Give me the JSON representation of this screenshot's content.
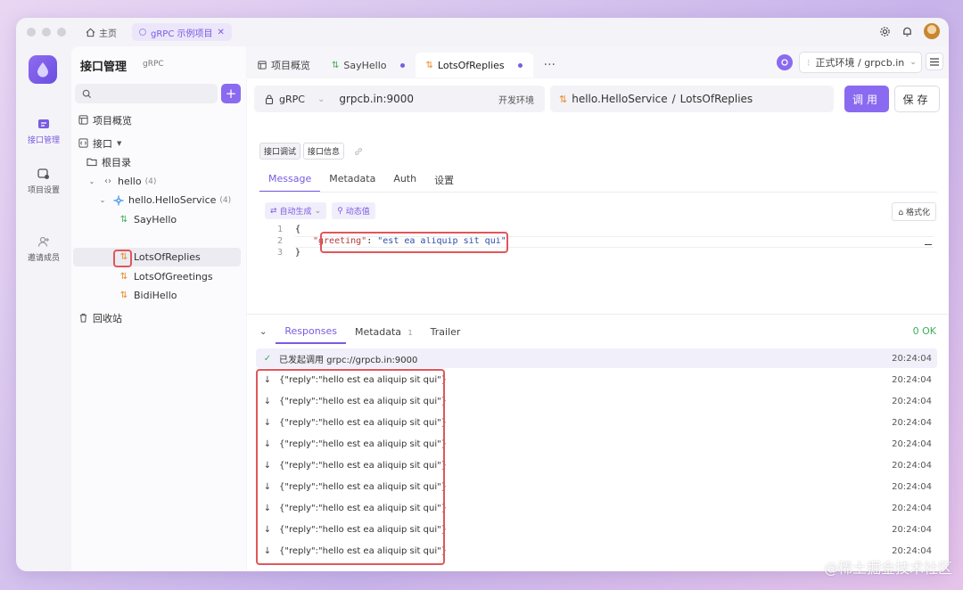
{
  "titlebar": {
    "home_label": "主页",
    "project_tab_label": "gRPC 示例项目"
  },
  "rail": {
    "items": [
      {
        "label": "接口管理",
        "icon": "api-icon",
        "active": true
      },
      {
        "label": "项目设置",
        "icon": "settings-icon",
        "active": false
      },
      {
        "label": "邀请成员",
        "icon": "add-user-icon",
        "active": false
      }
    ]
  },
  "sidebar": {
    "title": "接口管理",
    "badge": "gRPC",
    "search_placeholder": "",
    "tree": [
      {
        "label": "项目概览",
        "icon": "overview-icon"
      },
      {
        "label": "接口",
        "icon": "api-icon"
      },
      {
        "label": "根目录",
        "icon": "folder-icon"
      },
      {
        "label": "hello",
        "count": "(4)",
        "icon": "code-icon"
      },
      {
        "label": "hello.HelloService",
        "count": "(4)",
        "icon": "service-icon"
      },
      {
        "label": "SayHello",
        "icon": "unary-icon"
      },
      {
        "label": "LotsOfReplies",
        "icon": "stream-icon"
      },
      {
        "label": "LotsOfGreetings",
        "icon": "stream-icon"
      },
      {
        "label": "BidiHello",
        "icon": "stream-icon"
      },
      {
        "label": "回收站",
        "icon": "trash-icon"
      }
    ]
  },
  "tabs": [
    {
      "label": "项目概览"
    },
    {
      "label": "SayHello"
    },
    {
      "label": "LotsOfReplies"
    }
  ],
  "env": {
    "label": "正式环境 / grpcb.in"
  },
  "request": {
    "protocol": "gRPC",
    "host": "grpcb.in:9000",
    "env_label": "开发环境",
    "method_service": "hello.HelloService",
    "method_sep": "/",
    "method_name": "LotsOfReplies",
    "call_label": "调用",
    "save_label": "保存"
  },
  "subtabs": [
    "接口调试",
    "接口信息"
  ],
  "message_tabs": [
    "Message",
    "Metadata",
    "Auth",
    "设置"
  ],
  "editor": {
    "auto_gen": "自动生成",
    "dynamic": "动态值",
    "format": "格式化",
    "lines": [
      "1",
      "2",
      "3"
    ],
    "open_brace": "{",
    "key": "\"greeting\"",
    "colon": ": ",
    "value": "\"est ea aliquip sit qui\"",
    "close_brace": "}"
  },
  "responses": {
    "tabs": [
      {
        "label": "Responses"
      },
      {
        "label": "Metadata",
        "count": "1"
      },
      {
        "label": "Trailer"
      }
    ],
    "status": "0 OK",
    "first": {
      "text": "已发起调用 grpc://grpcb.in:9000",
      "time": "20:24:04"
    },
    "rows": [
      {
        "text": "{\"reply\":\"hello est ea aliquip sit qui\"}",
        "time": "20:24:04"
      },
      {
        "text": "{\"reply\":\"hello est ea aliquip sit qui\"}",
        "time": "20:24:04"
      },
      {
        "text": "{\"reply\":\"hello est ea aliquip sit qui\"}",
        "time": "20:24:04"
      },
      {
        "text": "{\"reply\":\"hello est ea aliquip sit qui\"}",
        "time": "20:24:04"
      },
      {
        "text": "{\"reply\":\"hello est ea aliquip sit qui\"}",
        "time": "20:24:04"
      },
      {
        "text": "{\"reply\":\"hello est ea aliquip sit qui\"}",
        "time": "20:24:04"
      },
      {
        "text": "{\"reply\":\"hello est ea aliquip sit qui\"}",
        "time": "20:24:04"
      },
      {
        "text": "{\"reply\":\"hello est ea aliquip sit qui\"}",
        "time": "20:24:04"
      },
      {
        "text": "{\"reply\":\"hello est ea aliquip sit qui\"}",
        "time": "20:24:04"
      }
    ]
  },
  "watermark": "@稀土掘金技术社区",
  "colors": {
    "accent": "#8a6af0",
    "highlight": "#e0575a",
    "ok": "#3fae5a"
  }
}
